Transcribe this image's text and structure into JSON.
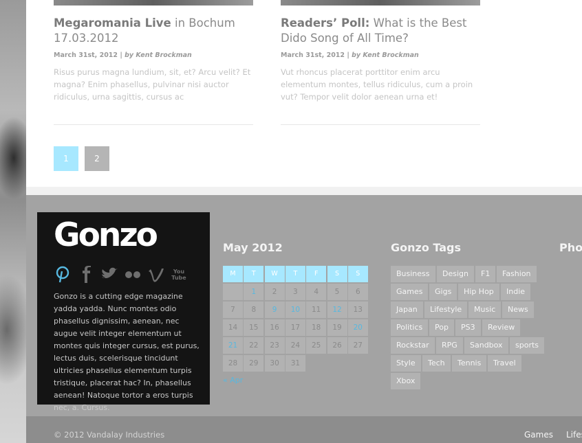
{
  "posts": [
    {
      "title_bold": "Megaromania Live",
      "title_rest": " in Bochum 17.03.2012",
      "date": "March 31st, 2012",
      "author": "by Kent Brockman",
      "excerpt": "Risus purus magna lundium, sit, et? Arcu velit? Et magna? Enim phasellus, pulvinar nisi auctor ridiculus, urna sagittis, cursus ac"
    },
    {
      "title_bold": "Readers’ Poll:",
      "title_rest": " What is the Best Dido Song of All Time?",
      "date": "March 31st, 2012",
      "author": "by Kent Brockman",
      "excerpt": "Vut rhoncus placerat porttitor enim arcu elementum montes, tellus ridiculus, cum a proin vut? Tempor velit dolor aenean urna et!"
    }
  ],
  "pagination": {
    "pages": [
      "1",
      "2"
    ],
    "current": "1"
  },
  "brand": {
    "logo": "Gonzo",
    "social_icons": [
      "pinterest-icon",
      "facebook-icon",
      "twitter-icon",
      "flickr-icon",
      "vimeo-icon",
      "youtube-icon"
    ],
    "youtube_label": "You Tube",
    "text": "Gonzo is a cutting edge magazine yadda yadda. Nunc montes odio phasellus dignissim, aenean, nec augue velit integer elementum ut montes quis integer cursus, est purus, lectus duis, scelerisque tincidunt ultricies phasellus elementum turpis tristique, placerat hac? In, phasellus aenean! Natoque tortor a eros turpis nec, a. Cursus."
  },
  "calendar": {
    "title": "May 2012",
    "days": [
      "M",
      "T",
      "W",
      "T",
      "F",
      "S",
      "S"
    ],
    "weeks": [
      [
        "",
        "1",
        "2",
        "3",
        "4",
        "5",
        "6"
      ],
      [
        "7",
        "8",
        "9",
        "10",
        "11",
        "12",
        "13"
      ],
      [
        "14",
        "15",
        "16",
        "17",
        "18",
        "19",
        "20"
      ],
      [
        "21",
        "22",
        "23",
        "24",
        "25",
        "26",
        "27"
      ],
      [
        "28",
        "29",
        "30",
        "31",
        "",
        "",
        ""
      ]
    ],
    "linked_days": [
      "1",
      "9",
      "10",
      "12",
      "20",
      "21"
    ],
    "prev_label": "« Apr"
  },
  "tags": {
    "title": "Gonzo Tags",
    "rows": [
      [
        "Business",
        "Design",
        "F1",
        "Fashion"
      ],
      [
        "Games",
        "Gigs",
        "Hip Hop",
        "Indie"
      ],
      [
        "Japan",
        "Lifestyle",
        "Music",
        "News"
      ],
      [
        "Politics",
        "Pop",
        "PS3",
        "Review"
      ],
      [
        "Rockstar",
        "RPG",
        "Sandbox",
        "sports"
      ],
      [
        "Style",
        "Tech",
        "Tennis",
        "Travel"
      ],
      [
        "Xbox"
      ]
    ]
  },
  "third_widget_title": "Phot",
  "footer": {
    "copyright": "© 2012 Vandalay Industries",
    "nav": [
      "Games",
      "Lifes"
    ]
  },
  "colors": {
    "accent": "#a7e8ff",
    "link": "#57b8e0",
    "footer_bg": "#a3a3a3",
    "brand_bg": "#141414"
  }
}
